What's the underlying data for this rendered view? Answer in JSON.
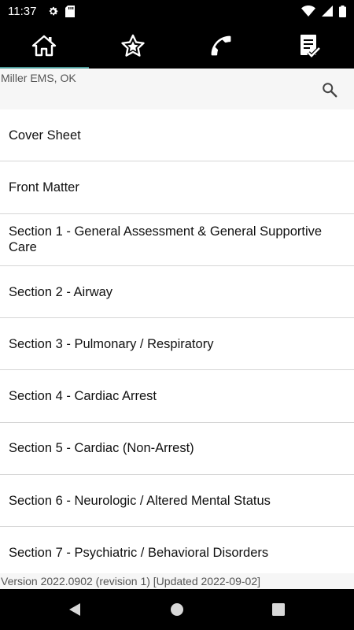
{
  "status_bar": {
    "time": "11:37",
    "left_icons": [
      "gear-icon",
      "sd-card-icon"
    ],
    "right_icons": [
      "wifi-icon",
      "signal-icon",
      "battery-icon"
    ]
  },
  "top_nav": {
    "tabs": [
      {
        "icon": "home-icon",
        "active": true
      },
      {
        "icon": "star-icon",
        "active": false
      },
      {
        "icon": "phone-icon",
        "active": false
      },
      {
        "icon": "checklist-icon",
        "active": false
      }
    ],
    "accent_color": "#4c9a98"
  },
  "header": {
    "agency_name": "Miller EMS, OK",
    "search_icon": "search-icon"
  },
  "list": {
    "items": [
      {
        "label": "Cover Sheet"
      },
      {
        "label": "Front Matter"
      },
      {
        "label": "Section 1 - General Assessment & General Supportive Care"
      },
      {
        "label": "Section 2 - Airway"
      },
      {
        "label": "Section 3 - Pulmonary / Respiratory"
      },
      {
        "label": "Section 4 - Cardiac Arrest"
      },
      {
        "label": "Section 5 - Cardiac (Non-Arrest)"
      },
      {
        "label": "Section 6 - Neurologic / Altered Mental Status"
      },
      {
        "label": "Section 7 - Psychiatric / Behavioral Disorders"
      }
    ]
  },
  "footer": {
    "version_text": "Version 2022.0902 (revision 1) [Updated 2022-09-02]"
  },
  "system_nav": {
    "buttons": [
      "back-icon",
      "home-circle-icon",
      "recents-icon"
    ]
  }
}
